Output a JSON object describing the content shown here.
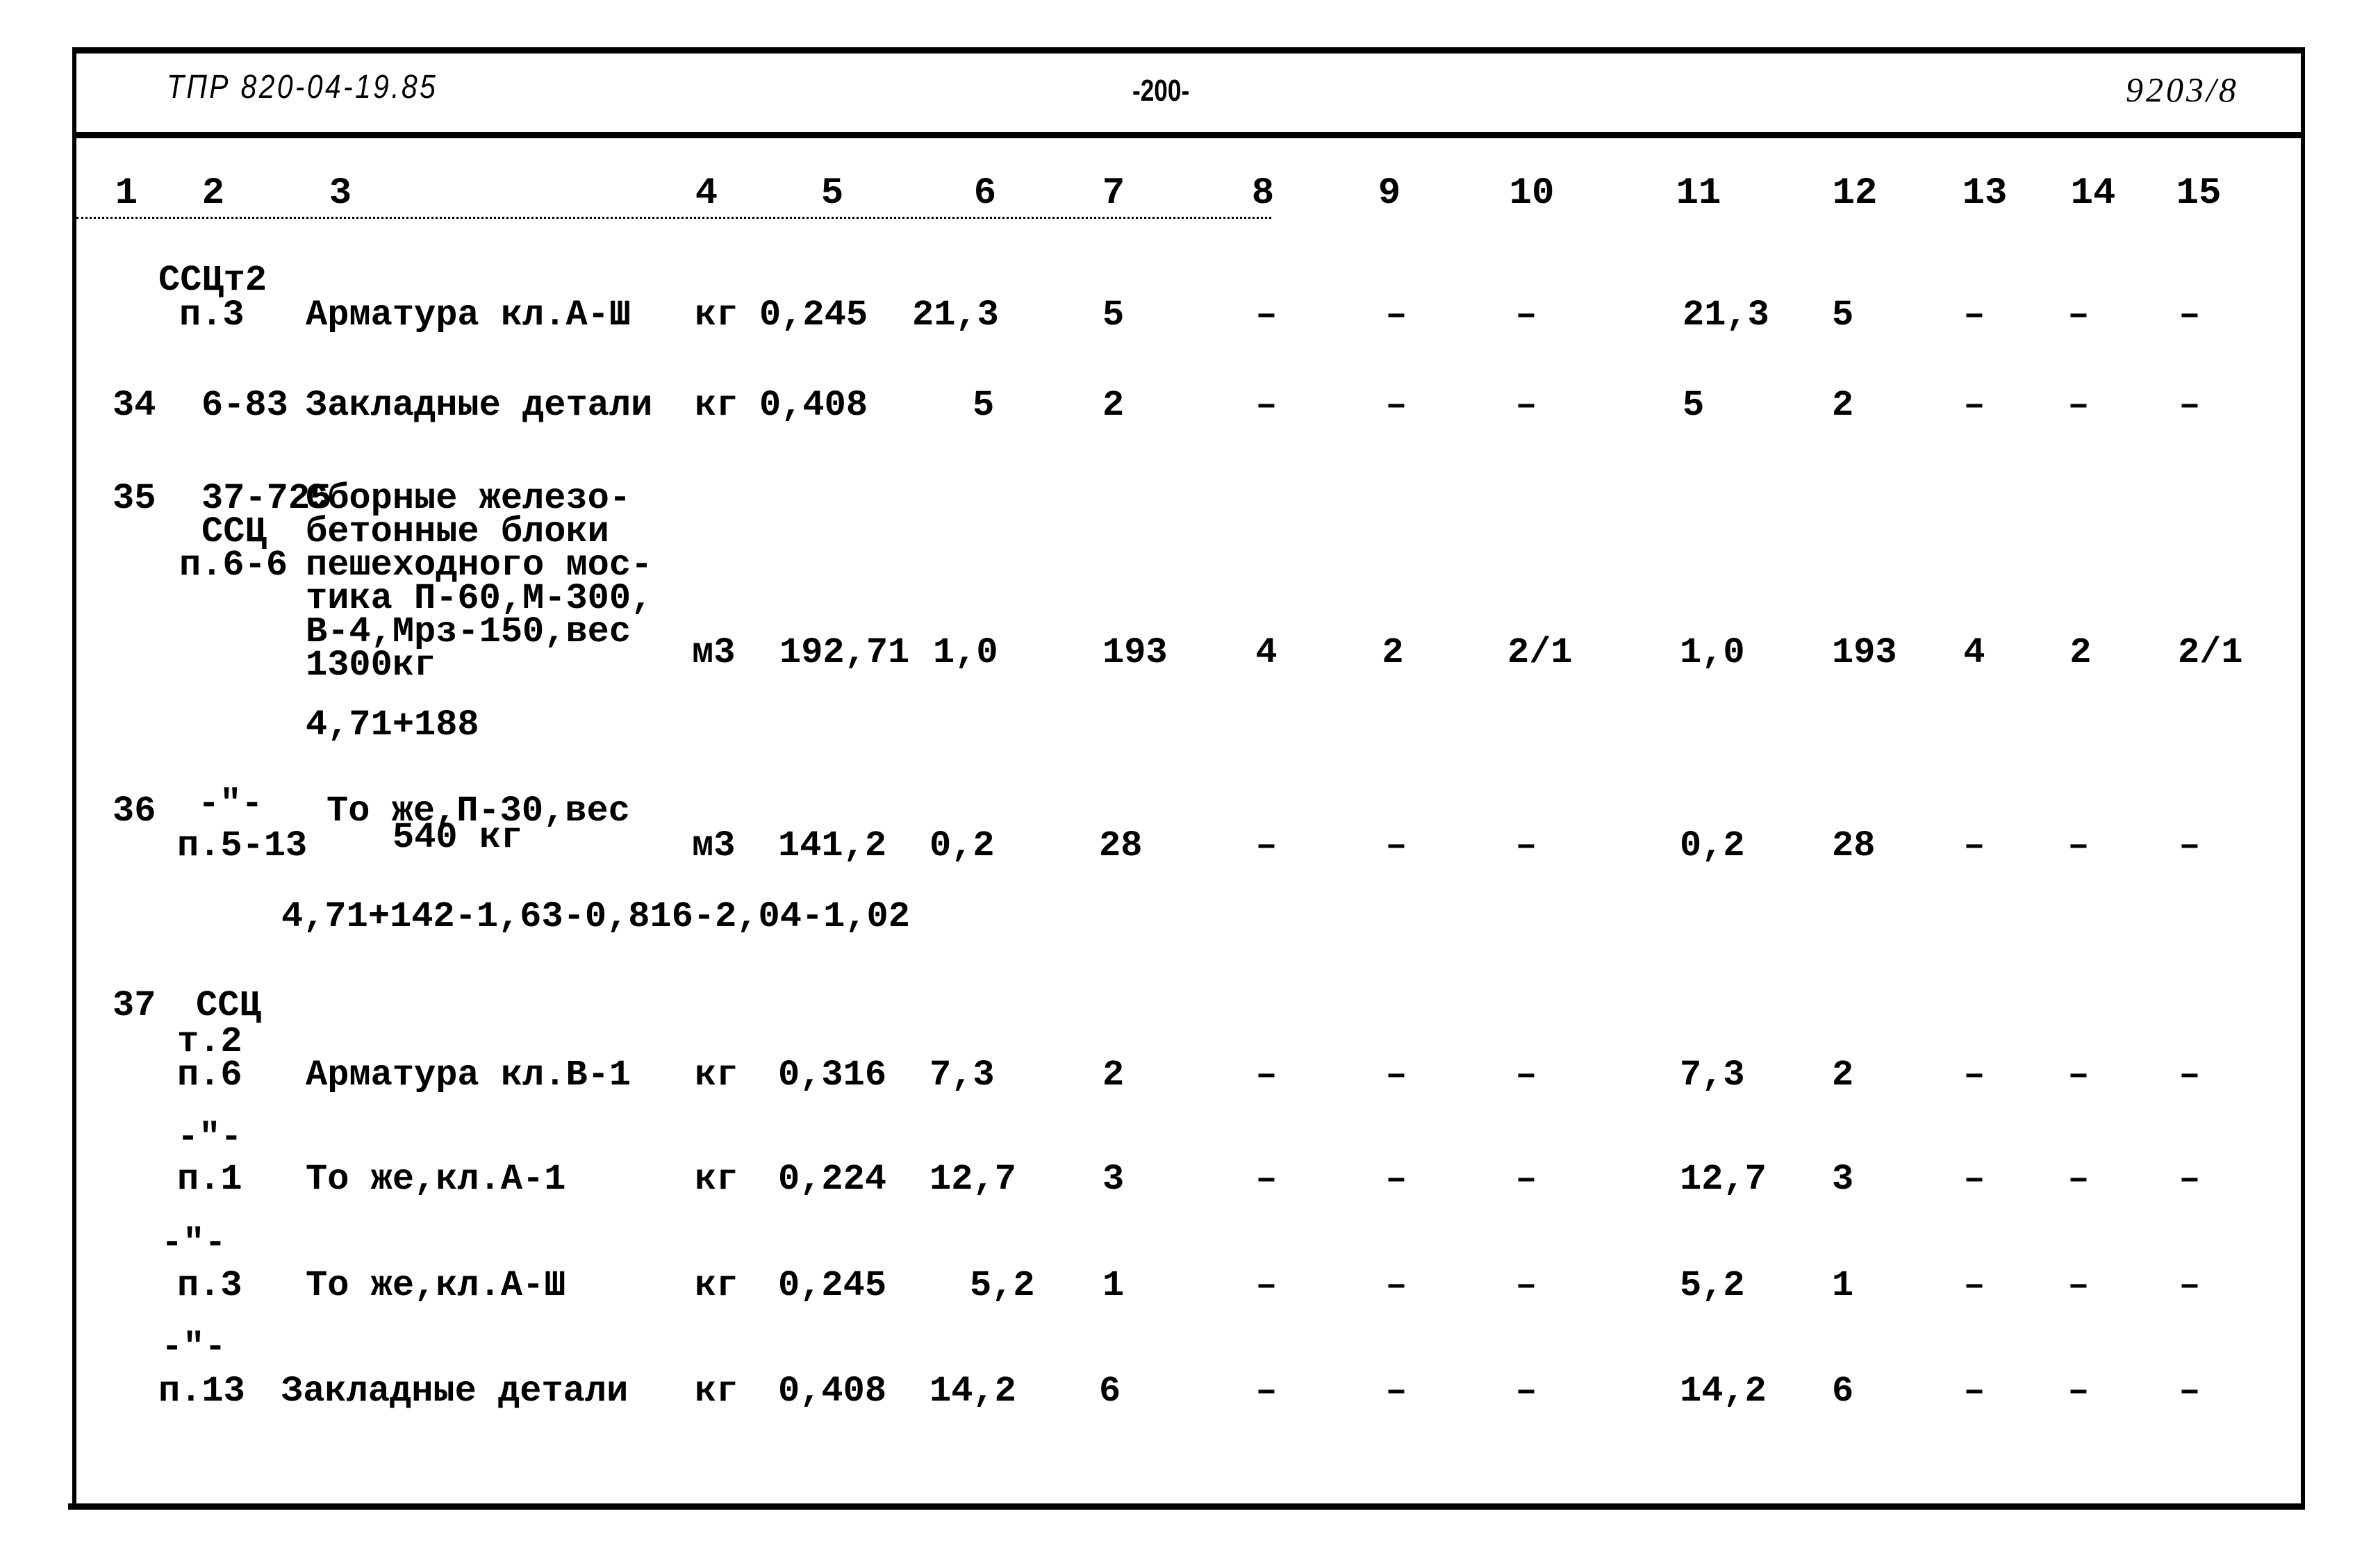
{
  "header": {
    "doc_code": "ТПР 820-04-19.85",
    "page": "-200-",
    "sheet_ref": "9203/8"
  },
  "column_numbers": [
    "1",
    "2",
    "3",
    "4",
    "5",
    "6",
    "7",
    "8",
    "9",
    "10",
    "11",
    "12",
    "13",
    "14",
    "15"
  ],
  "dash": "–",
  "ditto": "-\"-",
  "rows": [
    {
      "num": "",
      "ref": [
        "ССЦт2",
        "п.3"
      ],
      "description": [
        "Арматура кл.А-Ш"
      ],
      "unit": "кг",
      "c5": "0,245",
      "c6": "21,3",
      "c7": "5",
      "c8": "–",
      "c9": "–",
      "c10": "–",
      "c11": "21,3",
      "c12": "5",
      "c13": "–",
      "c14": "–",
      "c15": "–"
    },
    {
      "num": "34",
      "ref": [
        "6-83"
      ],
      "description": [
        "Закладные детали"
      ],
      "unit": "кг",
      "c5": "0,408",
      "c6": "5",
      "c7": "2",
      "c8": "–",
      "c9": "–",
      "c10": "–",
      "c11": "5",
      "c12": "2",
      "c13": "–",
      "c14": "–",
      "c15": "–"
    },
    {
      "num": "35",
      "ref": [
        "37-725",
        "ССЦ",
        "п.6-6"
      ],
      "description": [
        "Сборные железо-",
        "бетонные блоки",
        "пешеходного мос-",
        "тика П-60,М-300,",
        "В-4,Мрз-150,вес",
        "1300кг"
      ],
      "formula": "4,71+188",
      "unit": "м3",
      "c5": "192,71",
      "c6": "1,0",
      "c7": "193",
      "c8": "4",
      "c9": "2",
      "c10": "2/1",
      "c11": "1,0",
      "c12": "193",
      "c13": "4",
      "c14": "2",
      "c15": "2/1"
    },
    {
      "num": "36",
      "ref": [
        "-\"-",
        "п.5-13"
      ],
      "description": [
        "То же,П-30,вес",
        "540 кг"
      ],
      "formula": "4,71+142-1,63-0,816-2,04-1,02",
      "unit": "м3",
      "c5": "141,2",
      "c6": "0,2",
      "c7": "28",
      "c8": "–",
      "c9": "–",
      "c10": "–",
      "c11": "0,2",
      "c12": "28",
      "c13": "–",
      "c14": "–",
      "c15": "–"
    },
    {
      "num": "37",
      "ref": [
        "ССЦ",
        "т.2",
        "п.6"
      ],
      "description": [
        "Арматура кл.В-1"
      ],
      "unit": "кг",
      "c5": "0,316",
      "c6": "7,3",
      "c7": "2",
      "c8": "–",
      "c9": "–",
      "c10": "–",
      "c11": "7,3",
      "c12": "2",
      "c13": "–",
      "c14": "–",
      "c15": "–"
    },
    {
      "num": "",
      "ref": [
        "-\"-",
        "п.1"
      ],
      "description": [
        "То же,кл.А-1"
      ],
      "unit": "кг",
      "c5": "0,224",
      "c6": "12,7",
      "c7": "3",
      "c8": "–",
      "c9": "–",
      "c10": "–",
      "c11": "12,7",
      "c12": "3",
      "c13": "–",
      "c14": "–",
      "c15": "–"
    },
    {
      "num": "",
      "ref": [
        "-\"-",
        "п.3"
      ],
      "description": [
        "То же,кл.А-Ш"
      ],
      "unit": "кг",
      "c5": "0,245",
      "c6": "5,2",
      "c7": "1",
      "c8": "–",
      "c9": "–",
      "c10": "–",
      "c11": "5,2",
      "c12": "1",
      "c13": "–",
      "c14": "–",
      "c15": "–"
    },
    {
      "num": "",
      "ref": [
        "-\"-",
        "п.13"
      ],
      "description": [
        "Закладные детали"
      ],
      "unit": "кг",
      "c5": "0,408",
      "c6": "14,2",
      "c7": "6",
      "c8": "–",
      "c9": "–",
      "c10": "–",
      "c11": "14,2",
      "c12": "6",
      "c13": "–",
      "c14": "–",
      "c15": "–"
    }
  ]
}
